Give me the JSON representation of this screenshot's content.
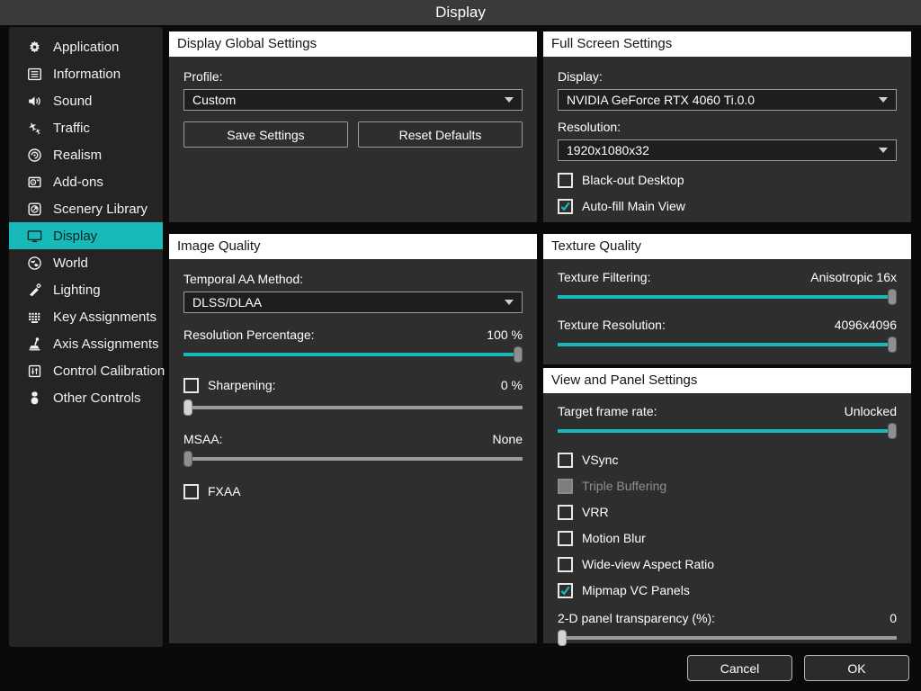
{
  "title_bar": {
    "title": "Display"
  },
  "colors": {
    "accent": "#18b9b9",
    "panel_bg": "#2e2e2e",
    "titlebar_bg": "#3a3a3c",
    "header_bg": "#ffffff"
  },
  "sidebar": {
    "items": [
      {
        "label": "Application",
        "selected": false
      },
      {
        "label": "Information",
        "selected": false
      },
      {
        "label": "Sound",
        "selected": false
      },
      {
        "label": "Traffic",
        "selected": false
      },
      {
        "label": "Realism",
        "selected": false
      },
      {
        "label": "Add-ons",
        "selected": false
      },
      {
        "label": "Scenery Library",
        "selected": false
      },
      {
        "label": "Display",
        "selected": true
      },
      {
        "label": "World",
        "selected": false
      },
      {
        "label": "Lighting",
        "selected": false
      },
      {
        "label": "Key Assignments",
        "selected": false
      },
      {
        "label": "Axis Assignments",
        "selected": false
      },
      {
        "label": "Control Calibration",
        "selected": false
      },
      {
        "label": "Other Controls",
        "selected": false
      }
    ]
  },
  "panels": {
    "display_global": {
      "title": "Display Global Settings",
      "profile": {
        "label": "Profile:",
        "value": "Custom"
      },
      "save_label": "Save Settings",
      "reset_label": "Reset Defaults"
    },
    "image_quality": {
      "title": "Image Quality",
      "temporal_aa": {
        "label": "Temporal AA Method:",
        "value": "DLSS/DLAA"
      },
      "resolution_percentage": {
        "label": "Resolution Percentage:",
        "value": "100 %"
      },
      "sharpening": {
        "label": "Sharpening:",
        "value": "0 %",
        "checked": false
      },
      "msaa": {
        "label": "MSAA:",
        "value": "None"
      },
      "fxaa": {
        "label": "FXAA",
        "checked": false
      }
    },
    "full_screen": {
      "title": "Full Screen Settings",
      "display": {
        "label": "Display:",
        "value": "NVIDIA GeForce RTX 4060 Ti.0.0"
      },
      "resolution": {
        "label": "Resolution:",
        "value": "1920x1080x32"
      },
      "blackout": {
        "label": "Black-out Desktop",
        "checked": false
      },
      "autofill": {
        "label": "Auto-fill Main View",
        "checked": true
      }
    },
    "texture_quality": {
      "title": "Texture Quality",
      "filtering": {
        "label": "Texture Filtering:",
        "value": "Anisotropic 16x"
      },
      "resolution": {
        "label": "Texture Resolution:",
        "value": "4096x4096"
      }
    },
    "view_panel": {
      "title": "View and Panel Settings",
      "frame_rate": {
        "label": "Target frame rate:",
        "value": "Unlocked"
      },
      "vsync": {
        "label": "VSync",
        "checked": false
      },
      "triple_buffering": {
        "label": "Triple Buffering",
        "checked": false,
        "disabled": true
      },
      "vrr": {
        "label": "VRR",
        "checked": false
      },
      "motion_blur": {
        "label": "Motion Blur",
        "checked": false
      },
      "wide_view": {
        "label": "Wide-view Aspect Ratio",
        "checked": false
      },
      "mipmap": {
        "label": "Mipmap VC Panels",
        "checked": true
      },
      "transparency": {
        "label": "2-D panel transparency (%):",
        "value": "0"
      }
    }
  },
  "footer": {
    "cancel_label": "Cancel",
    "ok_label": "OK"
  }
}
